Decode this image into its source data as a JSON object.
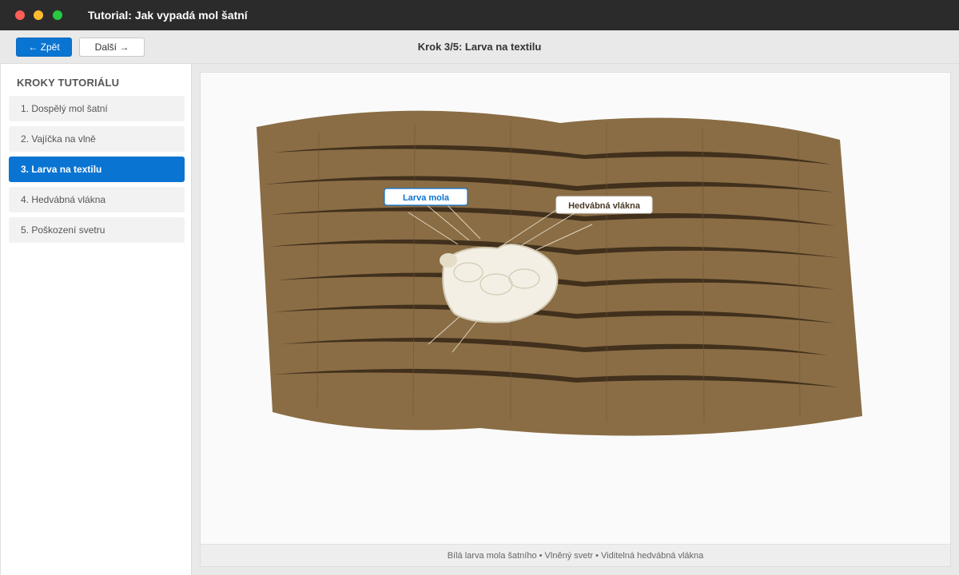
{
  "window": {
    "title": "Tutorial: Jak vypadá mol šatní"
  },
  "toolbar": {
    "back_label": "← Zpět",
    "next_label": "Další →",
    "step_title": "Krok 3/5: Larva na textilu"
  },
  "sidebar": {
    "heading": "KROKY TUTORIÁLU",
    "items": [
      {
        "label": "1. Dospělý mol šatní",
        "active": false
      },
      {
        "label": "2. Vajíčka na vlně",
        "active": false
      },
      {
        "label": "3. Larva na textilu",
        "active": true
      },
      {
        "label": "4. Hedvábná vlákna",
        "active": false
      },
      {
        "label": "5. Poškození svetru",
        "active": false
      }
    ]
  },
  "illustration": {
    "labels": {
      "larva": "Larva mola",
      "silk": "Hedvábná vlákna"
    },
    "colors": {
      "fabric": "#8a6d45",
      "groove": "#3a2a18",
      "larva": "#f3efe4",
      "accent": "#0a74d2"
    }
  },
  "caption": "Bílá larva mola šatního • Vlněný svetr • Viditelná hedvábná vlákna"
}
